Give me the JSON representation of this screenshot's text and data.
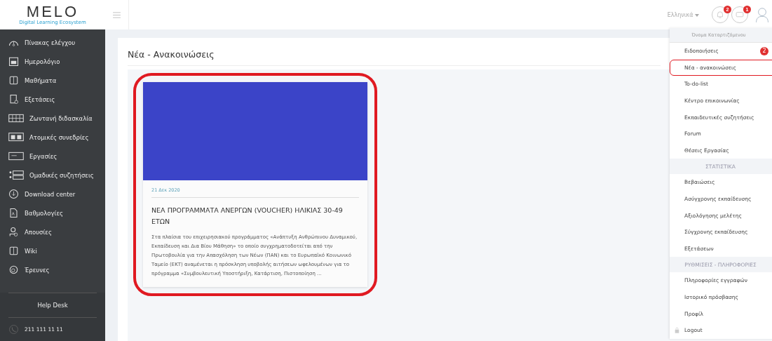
{
  "logo": {
    "name": "MELO",
    "tagline": "Digital Learning Ecosystem"
  },
  "sidebar": {
    "items": [
      {
        "label": "Πίνακας ελέγχου",
        "selected": false
      },
      {
        "label": "Ημερολόγιο",
        "selected": false
      },
      {
        "label": "Μαθήματα",
        "selected": false
      },
      {
        "label": "Εξετάσεις",
        "selected": false
      },
      {
        "label": "Ζωντανή διδασκαλία",
        "selected": false
      },
      {
        "label": "Ατομικές συνεδρίες",
        "selected": false
      },
      {
        "label": "Εργασίες",
        "selected": false
      },
      {
        "label": "Ομαδικές συζητήσεις",
        "selected": false
      },
      {
        "label": "Download center",
        "selected": false
      },
      {
        "label": "Βαθμολογίες",
        "selected": false
      },
      {
        "label": "Απουσίες",
        "selected": false
      },
      {
        "label": "Wiki",
        "selected": false
      },
      {
        "label": "Έρευνες",
        "selected": false
      }
    ],
    "help_desk": "Help Desk",
    "phone": "211 111 11 11"
  },
  "header": {
    "language": "Ελληνικά",
    "notifications_badge": "2",
    "messages_badge": "1"
  },
  "page": {
    "title": "Νέα - Ανακοινώσεις",
    "news": [
      {
        "date": "21 Δεκ 2020",
        "title": "ΝΕΑ ΠΡΟΓΡΑΜΜΑΤΑ ΑΝΕΡΓΩΝ (VOUCHER) ΗΛΙΚΙΑΣ 30-49 ΕΤΩΝ",
        "excerpt": "Στα πλαίσια του επιχειρησιακού προγράμματος «Ανάπτυξη Ανθρώπινου Δυναμικού, Εκπαίδευση και Δια Βίου Μάθηση» το οποίο συγχρηματοδοτείται από την Πρωτοβουλία για την Απασχόληση των Νέων (ΠΑΝ) και το Ευρωπαϊκό Κοινωνικό Ταμείο (ΕΚΤ) αναμένεται η πρόσκληση υποβολής αιτήσεων ωφελουμένων για το πρόγραμμα «Συμβουλευτική Υποστήριξη, Κατάρτιση, Πιστοποίηση ...",
        "highlighted": true
      }
    ]
  },
  "user_menu": {
    "user_name": "Όνομα Καταρτιζόμενου",
    "items": [
      {
        "kind": "item",
        "label": "Ειδοποιήσεις",
        "badge": "2",
        "highlighted": false
      },
      {
        "kind": "item",
        "label": "Νέα - ανακοινώσεις",
        "highlighted": true
      },
      {
        "kind": "item",
        "label": "To-do-list",
        "highlighted": false
      },
      {
        "kind": "item",
        "label": "Κέντρο επικοινωνίας",
        "highlighted": false
      },
      {
        "kind": "item",
        "label": "Εκπαιδευτικές συζητήσεις",
        "highlighted": false
      },
      {
        "kind": "item",
        "label": "Forum",
        "highlighted": false
      },
      {
        "kind": "item",
        "label": "Θέσεις Εργασίας",
        "highlighted": false
      },
      {
        "kind": "section",
        "label": "ΣΤΑΤΙΣΤΙΚΑ"
      },
      {
        "kind": "item",
        "label": "Βεβαιώσεις",
        "highlighted": false
      },
      {
        "kind": "item",
        "label": "Ασύγχρονης εκπαίδευσης",
        "highlighted": false
      },
      {
        "kind": "item",
        "label": "Αξιολόγησης μελέτης",
        "highlighted": false
      },
      {
        "kind": "item",
        "label": "Σύγχρονης εκπαίδευσης",
        "highlighted": false
      },
      {
        "kind": "item",
        "label": "Εξετάσεων",
        "highlighted": false
      },
      {
        "kind": "section",
        "label": "ΡΥΘΜΙΣΕΙΣ - ΠΛΗΡΟΦΟΡΙΕΣ"
      },
      {
        "kind": "item",
        "label": "Πληροφορίες εγγραφών",
        "highlighted": false
      },
      {
        "kind": "item",
        "label": "Ιστορικό πρόσβασης",
        "highlighted": false
      },
      {
        "kind": "item",
        "label": "Προφίλ",
        "highlighted": false
      },
      {
        "kind": "logout",
        "label": "Logout",
        "highlighted": false
      }
    ]
  }
}
